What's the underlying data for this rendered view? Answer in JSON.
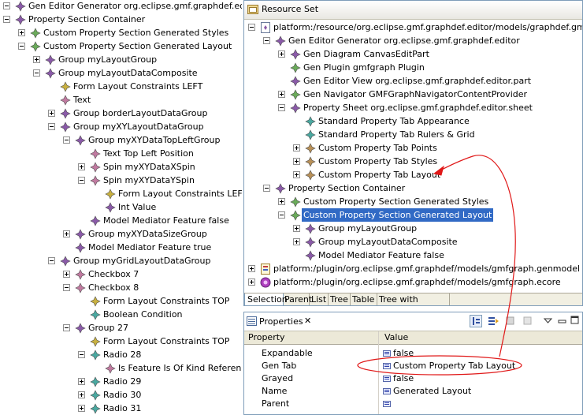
{
  "left_tree": {
    "rows": [
      {
        "depth": 0,
        "exp": "minus",
        "icon": "diamond-purple",
        "label": "Gen Editor Generator org.eclipse.gmf.graphdef.editor"
      },
      {
        "depth": 0,
        "exp": "minus",
        "icon": "diamond-purple",
        "label": "Property Section Container"
      },
      {
        "depth": 1,
        "exp": "plus",
        "icon": "diamond-green",
        "label": "Custom Property Section Generated Styles"
      },
      {
        "depth": 1,
        "exp": "minus",
        "icon": "diamond-green",
        "label": "Custom Property Section Generated Layout"
      },
      {
        "depth": 2,
        "exp": "plus",
        "icon": "diamond-purple",
        "label": "Group myLayoutGroup"
      },
      {
        "depth": 2,
        "exp": "minus",
        "icon": "diamond-purple",
        "label": "Group myLayoutDataComposite"
      },
      {
        "depth": 3,
        "exp": "none",
        "icon": "diamond-yellow",
        "label": "Form Layout Constraints LEFT"
      },
      {
        "depth": 3,
        "exp": "none",
        "icon": "diamond-pink",
        "label": "Text"
      },
      {
        "depth": 3,
        "exp": "plus",
        "icon": "diamond-purple",
        "label": "Group borderLayoutDataGroup"
      },
      {
        "depth": 3,
        "exp": "minus",
        "icon": "diamond-purple",
        "label": "Group myXYLayoutDataGroup"
      },
      {
        "depth": 4,
        "exp": "minus",
        "icon": "diamond-purple",
        "label": "Group myXYDataTopLeftGroup"
      },
      {
        "depth": 5,
        "exp": "none",
        "icon": "diamond-pink",
        "label": "Text Top Left Position"
      },
      {
        "depth": 5,
        "exp": "plus",
        "icon": "diamond-pink",
        "label": "Spin myXYDataXSpin"
      },
      {
        "depth": 5,
        "exp": "minus",
        "icon": "diamond-pink",
        "label": "Spin myXYDataYSpin"
      },
      {
        "depth": 6,
        "exp": "none",
        "icon": "diamond-yellow",
        "label": "Form Layout Constraints LEFT"
      },
      {
        "depth": 6,
        "exp": "none",
        "icon": "diamond-purple",
        "label": "Int Value"
      },
      {
        "depth": 5,
        "exp": "none",
        "icon": "diamond-purple",
        "label": "Model Mediator Feature false"
      },
      {
        "depth": 4,
        "exp": "plus",
        "icon": "diamond-purple",
        "label": "Group myXYDataSizeGroup"
      },
      {
        "depth": 4,
        "exp": "none",
        "icon": "diamond-purple",
        "label": "Model Mediator Feature true"
      },
      {
        "depth": 3,
        "exp": "minus",
        "icon": "diamond-purple",
        "label": "Group myGridLayoutDataGroup"
      },
      {
        "depth": 4,
        "exp": "plus",
        "icon": "diamond-pink",
        "label": "Checkbox 7"
      },
      {
        "depth": 4,
        "exp": "minus",
        "icon": "diamond-pink",
        "label": "Checkbox 8"
      },
      {
        "depth": 5,
        "exp": "none",
        "icon": "diamond-yellow",
        "label": "Form Layout Constraints TOP"
      },
      {
        "depth": 5,
        "exp": "none",
        "icon": "diamond-teal",
        "label": "Boolean Condition"
      },
      {
        "depth": 4,
        "exp": "minus",
        "icon": "diamond-purple",
        "label": "Group 27"
      },
      {
        "depth": 5,
        "exp": "none",
        "icon": "diamond-yellow",
        "label": "Form Layout Constraints TOP"
      },
      {
        "depth": 5,
        "exp": "minus",
        "icon": "diamond-teal",
        "label": "Radio 28"
      },
      {
        "depth": 6,
        "exp": "none",
        "icon": "diamond-pink",
        "label": "Is Feature Is Of Kind Reference"
      },
      {
        "depth": 5,
        "exp": "plus",
        "icon": "diamond-teal",
        "label": "Radio 29"
      },
      {
        "depth": 5,
        "exp": "plus",
        "icon": "diamond-teal",
        "label": "Radio 30"
      },
      {
        "depth": 5,
        "exp": "plus",
        "icon": "diamond-teal",
        "label": "Radio 31"
      }
    ]
  },
  "resource_panel": {
    "title": "Resource Set",
    "rows": [
      {
        "depth": 0,
        "exp": "minus",
        "icon": "resource",
        "label": "platform:/resource/org.eclipse.gmf.graphdef.editor/models/graphdef.gmfgen"
      },
      {
        "depth": 1,
        "exp": "minus",
        "icon": "diamond-purple",
        "label": "Gen Editor Generator org.eclipse.gmf.graphdef.editor"
      },
      {
        "depth": 2,
        "exp": "plus",
        "icon": "diamond-purple",
        "label": "Gen Diagram CanvasEditPart"
      },
      {
        "depth": 2,
        "exp": "none",
        "icon": "diamond-green",
        "label": "Gen Plugin gmfgraph Plugin"
      },
      {
        "depth": 2,
        "exp": "none",
        "icon": "diamond-purple",
        "label": "Gen Editor View org.eclipse.gmf.graphdef.editor.part"
      },
      {
        "depth": 2,
        "exp": "plus",
        "icon": "diamond-green",
        "label": "Gen Navigator GMFGraphNavigatorContentProvider"
      },
      {
        "depth": 2,
        "exp": "minus",
        "icon": "diamond-purple",
        "label": "Property Sheet org.eclipse.gmf.graphdef.editor.sheet"
      },
      {
        "depth": 3,
        "exp": "none",
        "icon": "diamond-teal",
        "label": "Standard Property Tab Appearance"
      },
      {
        "depth": 3,
        "exp": "none",
        "icon": "diamond-teal",
        "label": "Standard Property Tab Rulers & Grid"
      },
      {
        "depth": 3,
        "exp": "plus",
        "icon": "diamond-tan",
        "label": "Custom Property Tab Points"
      },
      {
        "depth": 3,
        "exp": "plus",
        "icon": "diamond-tan",
        "label": "Custom Property Tab Styles"
      },
      {
        "depth": 3,
        "exp": "plus",
        "icon": "diamond-tan",
        "label": "Custom Property Tab Layout"
      },
      {
        "depth": 1,
        "exp": "minus",
        "icon": "diamond-purple",
        "label": "Property Section Container"
      },
      {
        "depth": 2,
        "exp": "plus",
        "icon": "diamond-green",
        "label": "Custom Property Section Generated Styles"
      },
      {
        "depth": 2,
        "exp": "minus",
        "icon": "diamond-green",
        "label": "Custom Property Section Generated Layout",
        "selected": true
      },
      {
        "depth": 3,
        "exp": "plus",
        "icon": "diamond-purple",
        "label": "Group myLayoutGroup"
      },
      {
        "depth": 3,
        "exp": "plus",
        "icon": "diamond-purple",
        "label": "Group myLayoutDataComposite"
      },
      {
        "depth": 3,
        "exp": "none",
        "icon": "diamond-purple",
        "label": "Model Mediator Feature false"
      },
      {
        "depth": 0,
        "exp": "plus",
        "icon": "genmodel",
        "label": "platform:/plugin/org.eclipse.gmf.graphdef/models/gmfgraph.genmodel"
      },
      {
        "depth": 0,
        "exp": "plus",
        "icon": "ecore",
        "label": "platform:/plugin/org.eclipse.gmf.graphdef/models/gmfgraph.ecore"
      }
    ],
    "tabs": [
      "Selection",
      "Parent",
      "List",
      "Tree",
      "Table",
      "Tree with Columns"
    ]
  },
  "properties_panel": {
    "title": "Properties",
    "close": "✕",
    "col_property": "Property",
    "col_value": "Value",
    "rows": [
      {
        "name": "Expandable",
        "value": "false"
      },
      {
        "name": "Gen Tab",
        "value": "Custom Property Tab Layout"
      },
      {
        "name": "Grayed",
        "value": "false"
      },
      {
        "name": "Name",
        "value": "Generated Layout"
      },
      {
        "name": "Parent",
        "value": ""
      }
    ]
  },
  "colors": {
    "diamond-purple": "#8a5aa8",
    "diamond-green": "#6aaa5a",
    "diamond-yellow": "#c8b040",
    "diamond-pink": "#c07aa0",
    "diamond-teal": "#4aa8a0",
    "diamond-tan": "#b89058",
    "annotation": "#e01818",
    "selection": "#316ac5"
  }
}
